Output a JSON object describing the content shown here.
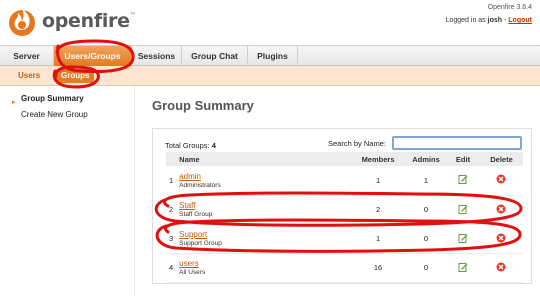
{
  "header": {
    "brand": "openfire",
    "trademark": "™",
    "version": "Openfire 3.6.4",
    "login_prefix": "Logged in as",
    "user": "josh",
    "logout_separator": "-",
    "logout": "Logout"
  },
  "mainnav": {
    "tabs": [
      {
        "label": "Server"
      },
      {
        "label": "Users/Groups",
        "active": true
      },
      {
        "label": "Sessions"
      },
      {
        "label": "Group Chat"
      },
      {
        "label": "Plugins"
      }
    ]
  },
  "subnav": {
    "tabs": [
      {
        "label": "Users"
      },
      {
        "label": "Groups",
        "active": true
      }
    ]
  },
  "sidebar": {
    "items": [
      {
        "label": "Group Summary",
        "current": true
      },
      {
        "label": "Create New Group"
      }
    ]
  },
  "page": {
    "title": "Group Summary",
    "total_label": "Total Groups:",
    "total_value": "4",
    "search_label": "Search by Name:",
    "search_value": ""
  },
  "table": {
    "headers": [
      "",
      "Name",
      "Members",
      "Admins",
      "Edit",
      "Delete"
    ],
    "rows": [
      {
        "num": "1",
        "name": "admin",
        "desc": "Administrators",
        "members": "1",
        "admins": "1"
      },
      {
        "num": "2",
        "name": "Staff",
        "desc": "Staff Group",
        "members": "2",
        "admins": "0"
      },
      {
        "num": "3",
        "name": "Support",
        "desc": "Support Group",
        "members": "1",
        "admins": "0"
      },
      {
        "num": "4",
        "name": "users",
        "desc": "All Users",
        "members": "16",
        "admins": "0"
      }
    ]
  },
  "colors": {
    "accent": "#e07b22",
    "subnav_bg": "#fce6d2",
    "link": "#c25a10",
    "annotation": "#e01010"
  }
}
